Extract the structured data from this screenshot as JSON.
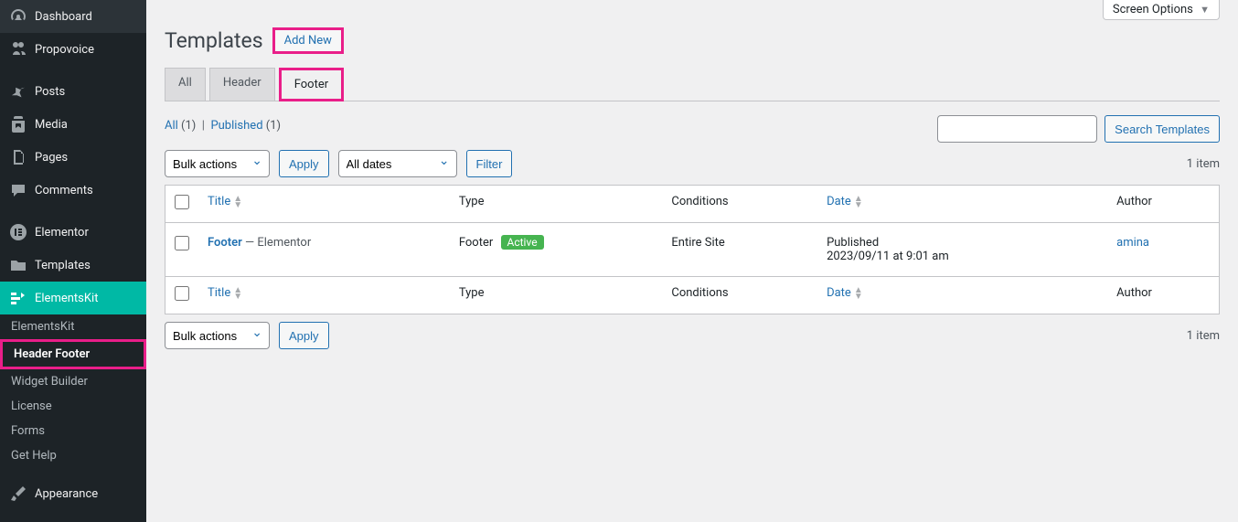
{
  "sidebar": {
    "items": [
      {
        "icon": "dashboard",
        "label": "Dashboard"
      },
      {
        "icon": "users",
        "label": "Propovoice"
      },
      {
        "icon": "pin",
        "label": "Posts"
      },
      {
        "icon": "media",
        "label": "Media"
      },
      {
        "icon": "pages",
        "label": "Pages"
      },
      {
        "icon": "comments",
        "label": "Comments"
      },
      {
        "icon": "elementor",
        "label": "Elementor"
      },
      {
        "icon": "folder",
        "label": "Templates"
      },
      {
        "icon": "elementskit",
        "label": "ElementsKit"
      },
      {
        "icon": "brush",
        "label": "Appearance"
      }
    ],
    "sub": [
      "ElementsKit",
      "Header Footer",
      "Widget Builder",
      "License",
      "Forms",
      "Get Help"
    ]
  },
  "screenOptions": "Screen Options",
  "heading": "Templates",
  "addNew": "Add New",
  "tabs": [
    "All",
    "Header",
    "Footer"
  ],
  "statusFilters": {
    "all": {
      "label": "All",
      "count": "(1)"
    },
    "sep": "|",
    "published": {
      "label": "Published",
      "count": "(1)"
    }
  },
  "search": {
    "button": "Search Templates"
  },
  "bulkActions": {
    "label": "Bulk actions",
    "apply": "Apply"
  },
  "dateFilter": {
    "label": "All dates",
    "filter": "Filter"
  },
  "itemCount": "1 item",
  "columns": {
    "title": "Title",
    "type": "Type",
    "conditions": "Conditions",
    "date": "Date",
    "author": "Author"
  },
  "rows": [
    {
      "title": "Footer",
      "suffix": " — Elementor",
      "type": "Footer",
      "active": "Active",
      "conditions": "Entire Site",
      "dateStatus": "Published",
      "dateTime": "2023/09/11 at 9:01 am",
      "author": "amina"
    }
  ]
}
